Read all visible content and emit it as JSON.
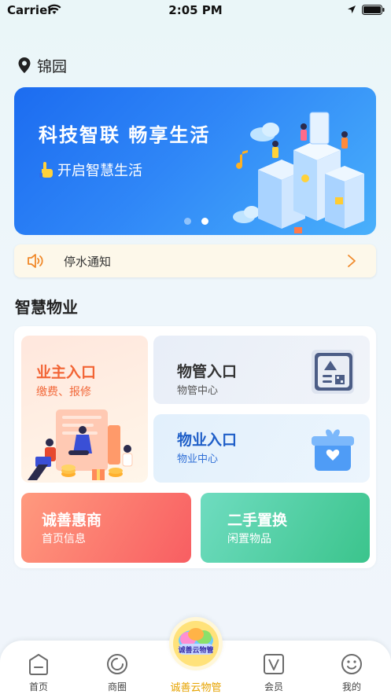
{
  "status_bar": {
    "carrier": "Carrier",
    "time": "2:05 PM"
  },
  "location": {
    "name": "锦园"
  },
  "banner": {
    "title": "科技智联 畅享生活",
    "subtitle": "开启智慧生活",
    "pages": 2,
    "active_page": 2
  },
  "notice": {
    "text": "停水通知"
  },
  "section": {
    "title": "智慧物业"
  },
  "cards": {
    "owner": {
      "title": "业主入口",
      "subtitle": "缴费、报修"
    },
    "management": {
      "title": "物管入口",
      "subtitle": "物管中心"
    },
    "property": {
      "title": "物业入口",
      "subtitle": "物业中心"
    },
    "merchant": {
      "title": "诚善惠商",
      "subtitle": "首页信息"
    },
    "secondhand": {
      "title": "二手置换",
      "subtitle": "闲置物品"
    }
  },
  "tabbar": {
    "items": [
      {
        "label": "首页",
        "icon": "home-icon"
      },
      {
        "label": "商圈",
        "icon": "circle-icon"
      },
      {
        "label": "诚善云物管",
        "icon": "chengshan-logo-icon",
        "logo_text": "诚善云物管"
      },
      {
        "label": "会员",
        "icon": "vip-icon"
      },
      {
        "label": "我的",
        "icon": "smile-icon"
      }
    ]
  },
  "colors": {
    "banner_blue": "#2f86f7",
    "owner_orange": "#f26435",
    "property_blue": "#1f5fc8",
    "merchant_red": "#f85e62",
    "secondhand_green": "#3bc48c",
    "tab_active": "#e6a300"
  }
}
